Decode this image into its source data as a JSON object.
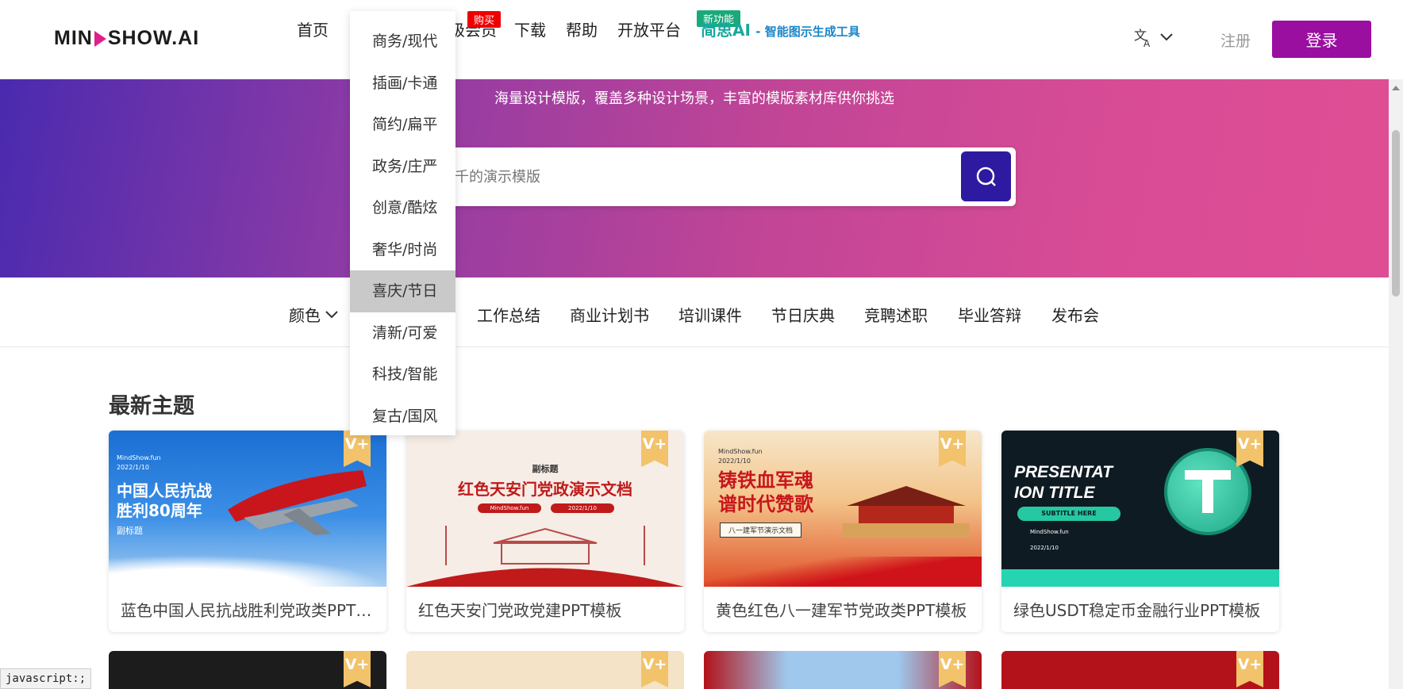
{
  "header": {
    "logo": {
      "left": "MIN",
      "right": "SHOW.AI"
    },
    "nav": {
      "home": "首页",
      "vip": "级会员",
      "download": "下载",
      "help": "帮助",
      "open_platform": "开放平台",
      "jiansi": "简思AI",
      "jiansi_sub": "- 智能图示生成工具"
    },
    "badges": {
      "buy": "购买",
      "new_feature": "新功能"
    },
    "register": "注册",
    "login": "登录"
  },
  "banner": {
    "subtitle": "海量设计模版，覆盖多种设计场景，丰富的模版素材库供你挑选",
    "search_placeholder": "上千的演示模版"
  },
  "categories": {
    "color": "颜色",
    "items": [
      "工作总结",
      "商业计划书",
      "培训课件",
      "节日庆典",
      "竞聘述职",
      "毕业答辩",
      "发布会"
    ]
  },
  "dropdown": {
    "items": [
      "商务/现代",
      "插画/卡通",
      "简约/扁平",
      "政务/庄严",
      "创意/酷炫",
      "奢华/时尚",
      "喜庆/节日",
      "清新/可爱",
      "科技/智能",
      "复古/国风"
    ],
    "active": "喜庆/节日"
  },
  "section": {
    "title": "最新主题",
    "cards": [
      {
        "caption": "蓝色中国人民抗战胜利党政类PPT模板",
        "thumb_title": "中国人民抗战\n胜利80周年",
        "thumb_sub": "副标题",
        "thumb_brand": "MindShow.fun",
        "thumb_date": "2022/1/10"
      },
      {
        "caption": "红色天安门党政党建PPT模板",
        "thumb_title": "红色天安门党政演示文档",
        "thumb_sub": "副标题",
        "thumb_brand": "MindShow.fun",
        "thumb_date": "2022/1/10"
      },
      {
        "caption": "黄色红色八一建军节党政类PPT模板",
        "thumb_title": "铸铁血军魂\n谱时代赞歌",
        "thumb_sub": "八一建军节演示文档",
        "thumb_brand": "MindShow.fun",
        "thumb_date": "2022/1/10"
      },
      {
        "caption": "绿色USDT稳定币金融行业PPT模板",
        "thumb_title": "PRESENTAT\nION TITLE",
        "thumb_sub": "SUBTITLE HERE",
        "thumb_brand": "MindShow.fun",
        "thumb_date": "2022/1/10"
      }
    ],
    "vip_label": "V+"
  },
  "statusbar": "javascript:;",
  "colors": {
    "brand_purple": "#9a0ea0",
    "search_btn": "#2e1aa0",
    "accent_pink": "#e0208c"
  }
}
